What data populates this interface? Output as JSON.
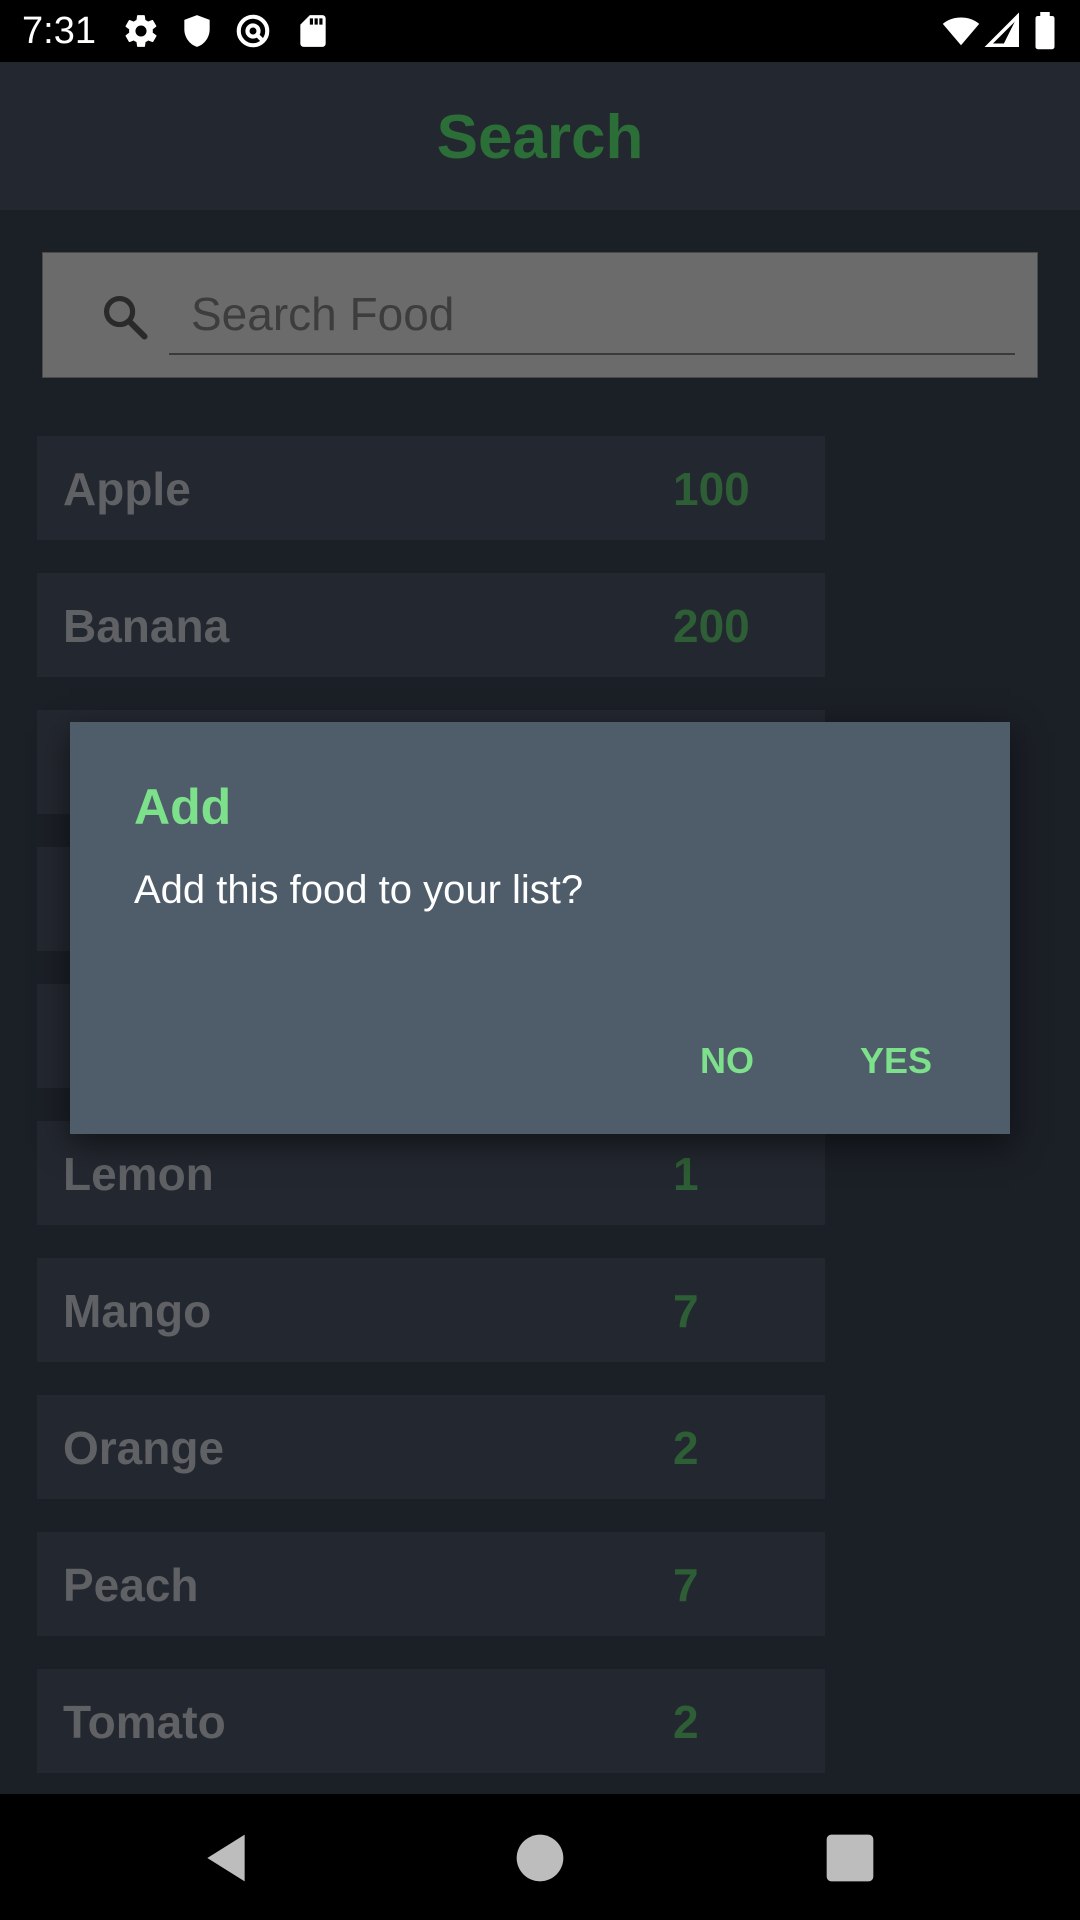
{
  "status_bar": {
    "time": "7:31",
    "icons": [
      "gear-icon",
      "shield-icon",
      "at-sign-icon",
      "sd-card-icon",
      "wifi-icon",
      "signal-icon",
      "battery-icon"
    ]
  },
  "app_bar": {
    "title": "Search"
  },
  "search": {
    "placeholder": "Search Food",
    "value": ""
  },
  "foods": [
    {
      "name": "Apple",
      "value": "100"
    },
    {
      "name": "Banana",
      "value": "200"
    },
    {
      "name": "",
      "value": ""
    },
    {
      "name": "",
      "value": ""
    },
    {
      "name": "",
      "value": ""
    },
    {
      "name": "Lemon",
      "value": "1"
    },
    {
      "name": "Mango",
      "value": "7"
    },
    {
      "name": "Orange",
      "value": "2"
    },
    {
      "name": "Peach",
      "value": "7"
    },
    {
      "name": "Tomato",
      "value": "2"
    }
  ],
  "dialog": {
    "title": "Add",
    "message": "Add this food to your list?",
    "no_label": "NO",
    "yes_label": "YES"
  },
  "colors": {
    "accent": "#7de08a",
    "title_green": "#2c6e37",
    "dialog_bg": "#4f5d6b",
    "background": "#1b1f26"
  }
}
